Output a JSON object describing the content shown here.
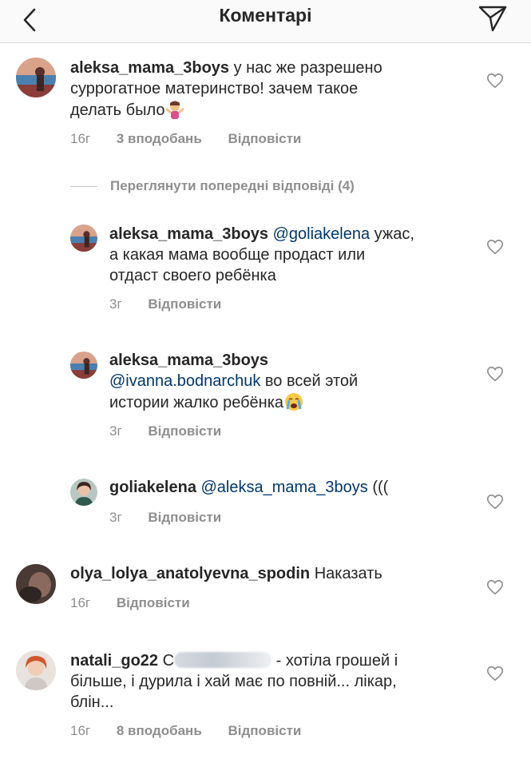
{
  "header": {
    "title": "Коментарі"
  },
  "view_previous_replies": "Переглянути попередні відповіді (4)",
  "comments": [
    {
      "username": "aleksa_mama_3boys",
      "text_line1": "у нас же разрешено",
      "text_line2": "суррогатное материнство! зачем такое",
      "text_line3": "делать было",
      "time": "16г",
      "likes": "3 вподобань",
      "reply": "Відповісти"
    },
    {
      "username": "aleksa_mama_3boys",
      "mention": "@goliakelena",
      "text_line1": "ужас,",
      "text_line2": "а какая мама вообще продаст или",
      "text_line3": "отдаст своего ребёнка",
      "time": "3г",
      "reply": "Відповісти"
    },
    {
      "username": "aleksa_mama_3boys",
      "mention": "@ivanna.bodnarchuk",
      "text_line1": "во всей этой",
      "text_line2": "истории жалко ребёнка",
      "time": "3г",
      "reply": "Відповісти"
    },
    {
      "username": "goliakelena",
      "mention": "@aleksa_mama_3boys",
      "text": "(((",
      "time": "3г",
      "reply": "Відповісти"
    },
    {
      "username": "olya_lolya_anatolyevna_spodin",
      "text": "Наказать",
      "time": "16г",
      "reply": "Відповісти"
    },
    {
      "username": "natali_go22",
      "text_prefix": "С",
      "text_line1": "- хотіла грошей і",
      "text_line2": "більше, і дурила і хай має по повній... лікар,",
      "text_line3": "блін...",
      "time": "16г",
      "likes": "8 вподобань",
      "reply": "Відповісти"
    }
  ],
  "colors": {
    "text": "#262626",
    "secondary": "#8e8e8e",
    "mention": "#00376b",
    "header_bg": "#fafafa"
  },
  "icons": [
    "back-arrow-icon",
    "direct-send-icon",
    "heart-icon"
  ]
}
